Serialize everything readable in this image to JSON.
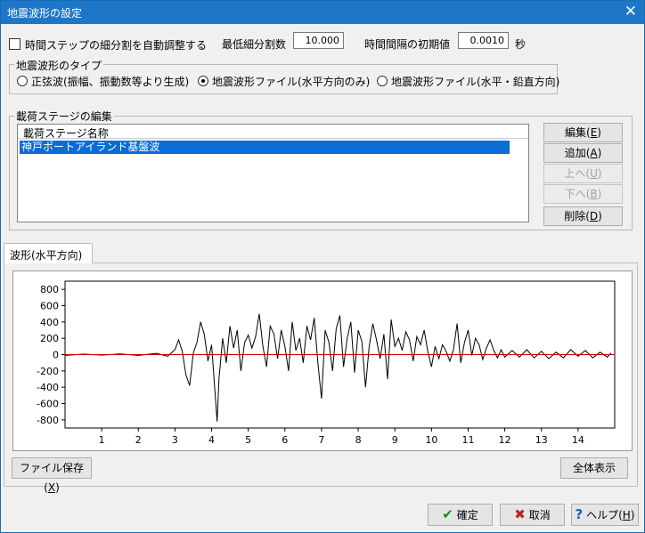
{
  "window": {
    "title": "地震波形の設定",
    "close_glyph": "✕"
  },
  "options": {
    "auto_adjust_label": "時間ステップの細分割を自動調整する",
    "auto_adjust_checked": false,
    "min_subdivision_label": "最低細分割数",
    "min_subdivision_value": "10.000",
    "initial_interval_label": "時間間隔の初期値",
    "initial_interval_value": "0.0010",
    "initial_interval_unit": "秒"
  },
  "wave_type": {
    "legend": "地震波形のタイプ",
    "options": [
      {
        "label": "正弦波(振幅、振動数等より生成)",
        "selected": false
      },
      {
        "label": "地震波形ファイル(水平方向のみ)",
        "selected": true
      },
      {
        "label": "地震波形ファイル(水平・鉛直方向)",
        "selected": false
      }
    ]
  },
  "stages": {
    "legend": "載荷ステージの編集",
    "column_header": "載荷ステージ名称",
    "items": [
      "神戸ポートアイランド基盤波"
    ],
    "buttons": [
      {
        "text": "編集(",
        "key": "E",
        "end": ")",
        "enabled": true
      },
      {
        "text": "追加(",
        "key": "A",
        "end": ")",
        "enabled": true
      },
      {
        "text": "上へ(",
        "key": "U",
        "end": ")",
        "enabled": false
      },
      {
        "text": "下へ(",
        "key": "B",
        "end": ")",
        "enabled": false
      },
      {
        "text": "削除(",
        "key": "D",
        "end": ")",
        "enabled": true
      }
    ]
  },
  "tab": {
    "label": "波形(水平方向)"
  },
  "chart_data": {
    "type": "line",
    "title": "",
    "xlabel": "",
    "ylabel": "",
    "xlim": [
      0,
      15
    ],
    "ylim": [
      -900,
      900
    ],
    "x_ticks": [
      1,
      2,
      3,
      4,
      5,
      6,
      7,
      8,
      9,
      10,
      11,
      12,
      13,
      14
    ],
    "y_ticks": [
      800,
      600,
      400,
      200,
      0,
      -200,
      -400,
      -600,
      -800
    ],
    "colors": {
      "wave": "#000000",
      "zero_line": "#d00000"
    },
    "series": [
      {
        "x": [
          0,
          0.5,
          1,
          1.5,
          2,
          2.5,
          2.8,
          3.0,
          3.1,
          3.2,
          3.3,
          3.4,
          3.5,
          3.6,
          3.7,
          3.8,
          3.9,
          4.0,
          4.1,
          4.15,
          4.2,
          4.3,
          4.4,
          4.5,
          4.6,
          4.7,
          4.8,
          4.9,
          5.0,
          5.1,
          5.2,
          5.3,
          5.4,
          5.5,
          5.6,
          5.7,
          5.8,
          5.9,
          6.0,
          6.1,
          6.2,
          6.3,
          6.4,
          6.5,
          6.6,
          6.7,
          6.8,
          6.9,
          7.0,
          7.1,
          7.2,
          7.3,
          7.4,
          7.5,
          7.6,
          7.7,
          7.8,
          7.9,
          8.0,
          8.1,
          8.2,
          8.3,
          8.4,
          8.5,
          8.6,
          8.7,
          8.8,
          8.9,
          9.0,
          9.1,
          9.2,
          9.3,
          9.4,
          9.5,
          9.6,
          9.7,
          9.8,
          9.9,
          10.0,
          10.1,
          10.2,
          10.3,
          10.4,
          10.5,
          10.6,
          10.7,
          10.8,
          10.9,
          11.0,
          11.1,
          11.2,
          11.3,
          11.4,
          11.5,
          11.6,
          11.7,
          11.8,
          11.9,
          12.0,
          12.2,
          12.4,
          12.6,
          12.8,
          13.0,
          13.2,
          13.4,
          13.6,
          13.8,
          14.0,
          14.2,
          14.4,
          14.6,
          14.8,
          14.9
        ],
        "y": [
          -10,
          5,
          -5,
          8,
          -10,
          15,
          -20,
          60,
          180,
          40,
          -250,
          -380,
          20,
          150,
          400,
          250,
          -80,
          120,
          -500,
          -820,
          -300,
          200,
          -100,
          350,
          80,
          300,
          -200,
          150,
          240,
          80,
          220,
          500,
          100,
          -150,
          350,
          250,
          -50,
          300,
          100,
          -200,
          400,
          50,
          200,
          -100,
          350,
          180,
          450,
          -100,
          -540,
          300,
          150,
          -200,
          320,
          480,
          -150,
          200,
          400,
          -220,
          300,
          160,
          -400,
          100,
          380,
          180,
          -50,
          250,
          -300,
          430,
          100,
          200,
          50,
          280,
          180,
          -80,
          220,
          120,
          300,
          40,
          -150,
          100,
          -50,
          120,
          40,
          -80,
          60,
          380,
          -100,
          150,
          300,
          -10,
          200,
          120,
          -60,
          80,
          180,
          50,
          -40,
          60,
          -30,
          50,
          -30,
          60,
          -40,
          40,
          -50,
          30,
          -40,
          60,
          -20,
          50,
          -40,
          30,
          -30,
          20
        ]
      }
    ]
  },
  "panel_buttons": {
    "save": {
      "text": "ファイル保存(",
      "key": "X",
      "end": ")"
    },
    "fit": "全体表示"
  },
  "footer": {
    "ok": "確定",
    "cancel": "取消",
    "help_text": "ヘルプ(",
    "help_key": "H",
    "help_end": ")"
  }
}
